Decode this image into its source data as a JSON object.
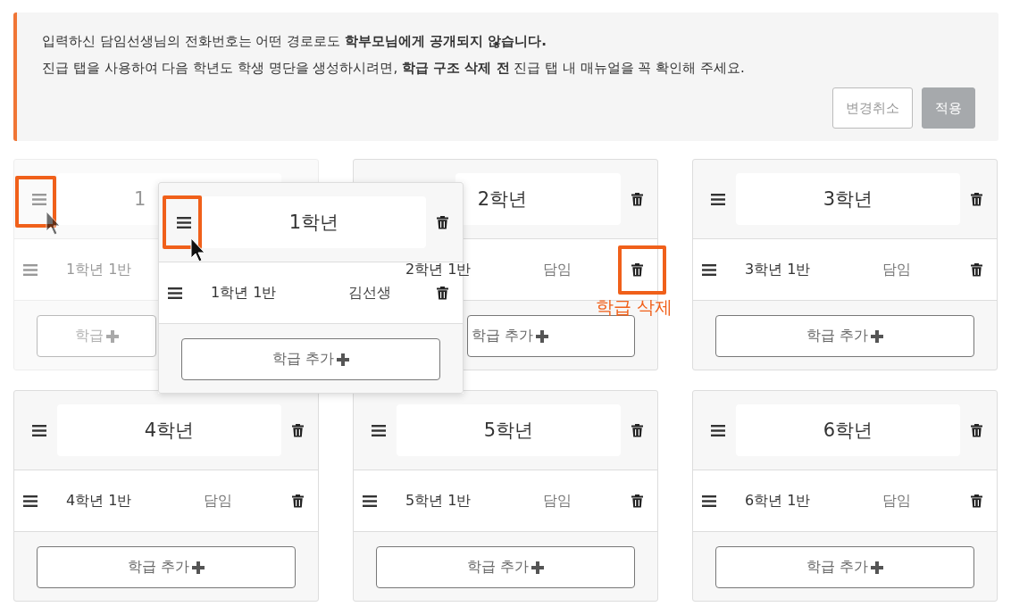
{
  "notice": {
    "lines": [
      "입력하신 담임선생님의 전화번호는 어떤 경로로도 **학부모님에게 공개되지 않습니다.**",
      "진급 탭을 사용하여 다음 학년도 학생 명단을 생성하시려면, **학급 구조 삭제 전** 진급 탭 내 매뉴얼을 꼭 확인해 주세요."
    ],
    "buttons": [
      {
        "label": "변경취소",
        "kind": "outline",
        "disabled": true
      },
      {
        "label": "적용",
        "kind": "primary",
        "disabled": true
      }
    ]
  },
  "grades": [
    {
      "title": "1",
      "dragging": true,
      "classes": [
        {
          "name": "1학년 1반"
        }
      ],
      "add_label": "학급"
    },
    {
      "title": "2학년",
      "dragging": false,
      "classes": [
        {
          "name": "2학년 1반",
          "teacher": {
            "placeholder": "담임"
          }
        }
      ],
      "add_label": "학급 추가"
    },
    {
      "title": "3학년",
      "dragging": false,
      "classes": [
        {
          "name": "3학년 1반",
          "teacher": {
            "placeholder": "담임"
          }
        }
      ],
      "add_label": "학급 추가"
    },
    {
      "title": "4학년",
      "dragging": false,
      "classes": [
        {
          "name": "4학년 1반",
          "teacher": {
            "placeholder": "담임"
          }
        }
      ],
      "add_label": "학급 추가"
    },
    {
      "title": "5학년",
      "dragging": false,
      "classes": [
        {
          "name": "5학년 1반",
          "teacher": {
            "placeholder": "담임"
          }
        }
      ],
      "add_label": "학급 추가"
    },
    {
      "title": "6학년",
      "dragging": false,
      "classes": [
        {
          "name": "6학년 1반",
          "teacher": {
            "placeholder": "담임"
          }
        }
      ],
      "add_label": "학급 추가"
    }
  ],
  "drag_preview": {
    "title": "1학년",
    "classes": [
      {
        "name": "1학년 1반",
        "teacher": {
          "value": "김선생"
        }
      }
    ],
    "add_label": "학급 추가"
  },
  "callout": {
    "label": "학급 삭제"
  }
}
